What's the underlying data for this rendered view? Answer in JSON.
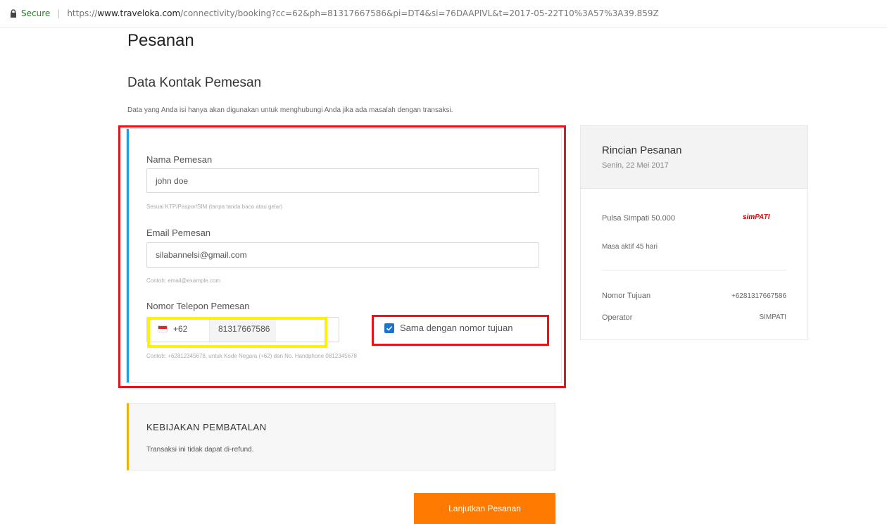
{
  "browser": {
    "secure_label": "Secure",
    "url_scheme": "https://",
    "url_domain": "www.traveloka.com",
    "url_rest": "/connectivity/booking?cc=62&ph=81317667586&pi=DT4&si=76DAAPIVL&t=2017-05-22T10%3A57%3A39.859Z"
  },
  "page": {
    "title": "Pesanan",
    "section_title": "Data Kontak Pemesan",
    "description": "Data yang Anda isi hanya akan digunakan untuk menghubungi Anda jika ada masalah dengan transaksi."
  },
  "form": {
    "name_label": "Nama Pemesan",
    "name_value": "john doe",
    "name_hint": "Sesuai KTP/Paspor/SIM (tanpa tanda baca atau gelar)",
    "email_label": "Email Pemesan",
    "email_value": "silabannelsi@gmail.com",
    "email_hint": "Contoh: email@example.com",
    "phone_label": "Nomor Telepon Pemesan",
    "country_code": "+62",
    "phone_value": "81317667586",
    "phone_hint": "Contoh: +62812345678, untuk Kode Negara (+62) dan No. Handphone 0812345678",
    "same_as_target_label": "Sama dengan nomor tujuan"
  },
  "policy": {
    "title": "KEBIJAKAN PEMBATALAN",
    "text": "Transaksi ini tidak dapat di-refund."
  },
  "button": {
    "continue_label": "Lanjutkan Pesanan"
  },
  "summary": {
    "title": "Rincian Pesanan",
    "date": "Senin, 22 Mei 2017",
    "product": "Pulsa Simpati 50.000",
    "brand_prefix": "sim",
    "brand_suffix": "PATI",
    "validity": "Masa aktif 45 hari",
    "target_label": "Nomor Tujuan",
    "target_value": "+6281317667586",
    "operator_label": "Operator",
    "operator_value": "SIMPATI"
  },
  "colors": {
    "annotation_red": "#e8141a",
    "annotation_yellow": "#fff200",
    "primary_orange": "#ff7a00",
    "accent_blue": "#1ba0e2"
  }
}
